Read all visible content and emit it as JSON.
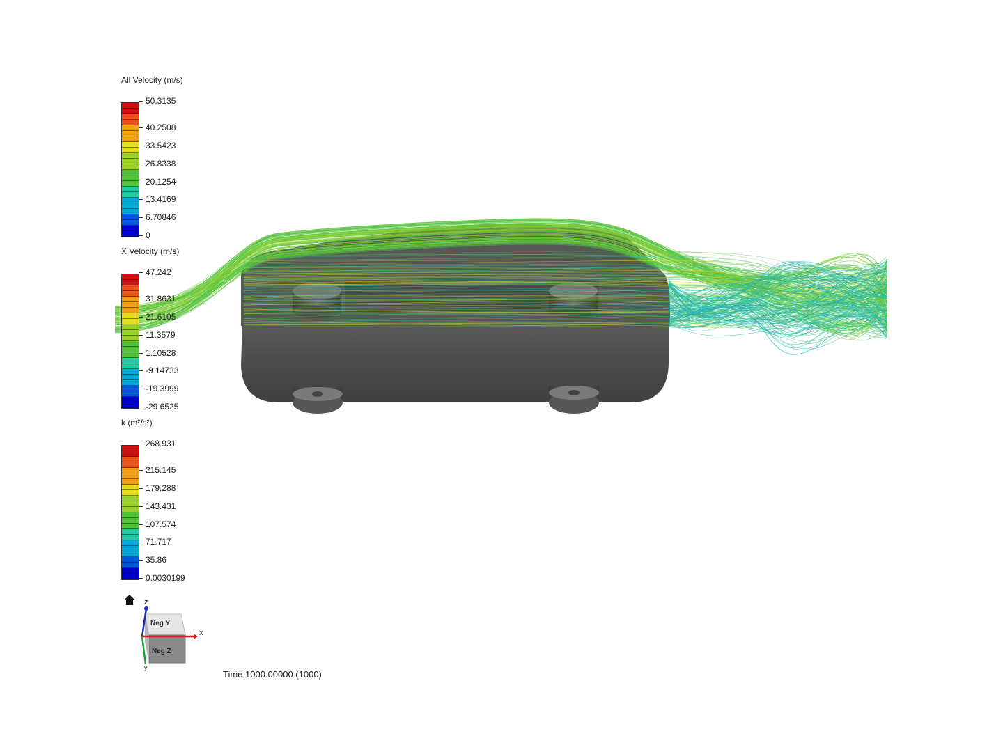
{
  "legends": [
    {
      "title": "All Velocity (m/s)",
      "ticks": [
        "50.3135",
        "40.2508",
        "33.5423",
        "26.8338",
        "20.1254",
        "13.4169",
        "6.70846",
        "0"
      ]
    },
    {
      "title": "X Velocity (m/s)",
      "ticks": [
        "47.242",
        "31.8631",
        "21.6105",
        "11.3579",
        "1.10528",
        "-9.14733",
        "-19.3999",
        "-29.6525"
      ]
    },
    {
      "title": "k (m²/s²)",
      "ticks": [
        "268.931",
        "215.145",
        "179.288",
        "143.431",
        "107.574",
        "71.717",
        "35.86",
        "0.0030199"
      ]
    }
  ],
  "orientation": {
    "z_label": "z",
    "x_label": "x",
    "y_label": "y",
    "top_face": "Neg Y",
    "front_face": "Neg Z",
    "home_icon": "home-icon"
  },
  "time_label": "Time 1000.00000 (1000)",
  "colors": {
    "car_body": "#4d4d4d",
    "background": "#ffffff",
    "colormap": [
      "#0000cc",
      "#0057d9",
      "#00a6d6",
      "#22c7a2",
      "#52c23a",
      "#9bd22a",
      "#e3dd1e",
      "#f29f18",
      "#e7521a",
      "#cc1010"
    ]
  }
}
